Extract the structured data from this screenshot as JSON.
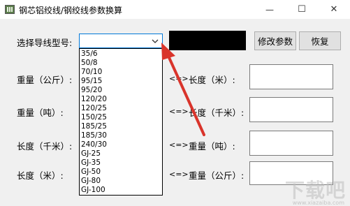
{
  "window": {
    "title": "钢芯铝绞线/钢绞线参数换算",
    "minimize": "—",
    "maximize": "☐",
    "close": "✕"
  },
  "form": {
    "select_label": "选择导线型号:",
    "combo_value": "",
    "modify_button": "修改参数",
    "restore_button": "恢复",
    "rows": [
      {
        "left_label": "重量（公斤）:",
        "arrow": "<=>",
        "right_label": "长度（米）:"
      },
      {
        "left_label": "重量（吨）:",
        "arrow": "<=>",
        "right_label": "长度（千米）:"
      },
      {
        "left_label": "长度（千米）:",
        "arrow": "<=>",
        "right_label": "重量（吨）:"
      },
      {
        "left_label": "长度（米）:",
        "arrow": "<=>",
        "right_label": "重量（公斤）:"
      }
    ]
  },
  "dropdown": {
    "options": [
      "35/6",
      "50/8",
      "70/10",
      "95/15",
      "95/20",
      "120/20",
      "120/25",
      "150/25",
      "185/25",
      "185/30",
      "240/30",
      "GJ-25",
      "GJ-35",
      "GJ-50",
      "GJ-80",
      "GJ-100"
    ]
  },
  "watermark": {
    "text": "下载吧",
    "sub": "www.xiazaiba.com"
  },
  "colors": {
    "annotation_arrow": "#d9342b",
    "combo_focus": "#0078d7"
  }
}
